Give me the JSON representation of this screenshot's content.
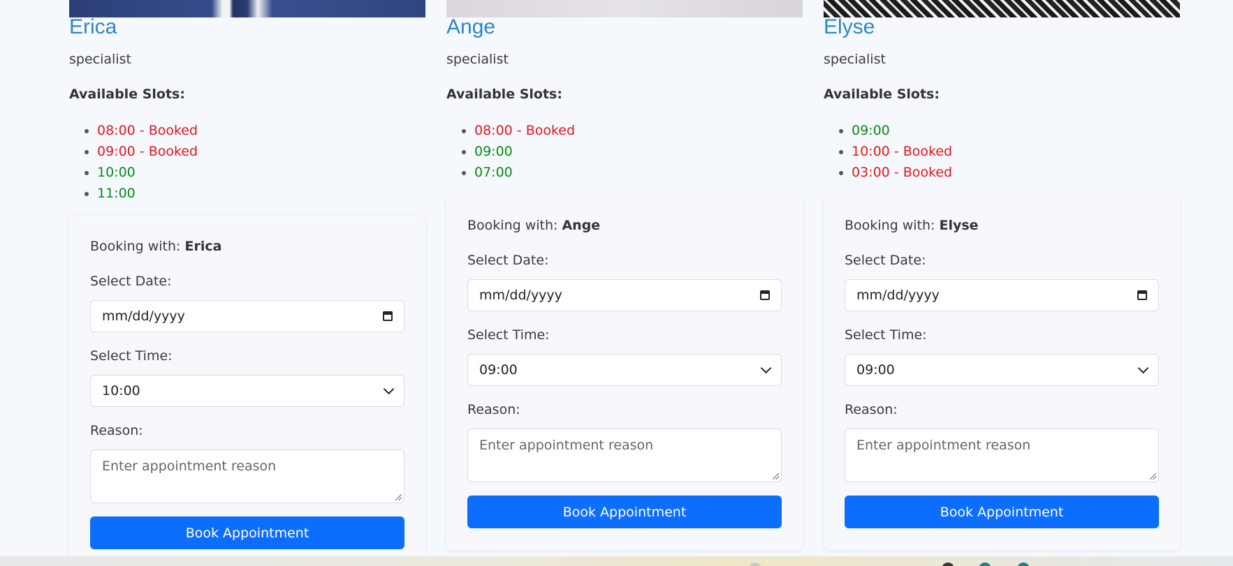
{
  "doctors": [
    {
      "name": "Erica",
      "role": "specialist",
      "slots_title": "Available Slots:",
      "slots": [
        {
          "text": "08:00 - Booked",
          "status": "booked"
        },
        {
          "text": "09:00 - Booked",
          "status": "booked"
        },
        {
          "text": "10:00",
          "status": "available"
        },
        {
          "text": "11:00",
          "status": "available"
        }
      ],
      "booking": {
        "booking_with_label": "Booking with:",
        "booking_with_name": "Erica",
        "date_label": "Select Date:",
        "date_value": "mm/dd/yyyy",
        "time_label": "Select Time:",
        "time_value": "10:00",
        "reason_label": "Reason:",
        "reason_placeholder": "Enter appointment reason",
        "button_label": "Book Appointment"
      }
    },
    {
      "name": "Ange",
      "role": "specialist",
      "slots_title": "Available Slots:",
      "slots": [
        {
          "text": "08:00 - Booked",
          "status": "booked"
        },
        {
          "text": "09:00",
          "status": "available"
        },
        {
          "text": "07:00",
          "status": "available"
        }
      ],
      "booking": {
        "booking_with_label": "Booking with:",
        "booking_with_name": "Ange",
        "date_label": "Select Date:",
        "date_value": "mm/dd/yyyy",
        "time_label": "Select Time:",
        "time_value": "09:00",
        "reason_label": "Reason:",
        "reason_placeholder": "Enter appointment reason",
        "button_label": "Book Appointment"
      }
    },
    {
      "name": "Elyse",
      "role": "specialist",
      "slots_title": "Available Slots:",
      "slots": [
        {
          "text": "09:00",
          "status": "available"
        },
        {
          "text": "10:00 - Booked",
          "status": "booked"
        },
        {
          "text": "03:00 - Booked",
          "status": "booked"
        }
      ],
      "booking": {
        "booking_with_label": "Booking with:",
        "booking_with_name": "Elyse",
        "date_label": "Select Date:",
        "date_value": "mm/dd/yyyy",
        "time_label": "Select Time:",
        "time_value": "09:00",
        "reason_label": "Reason:",
        "reason_placeholder": "Enter appointment reason",
        "button_label": "Book Appointment"
      }
    }
  ],
  "colors": {
    "name": "#2f86c6",
    "available": "#0a8a12",
    "booked": "#e4161c",
    "primary_button": "#0d6efd"
  }
}
